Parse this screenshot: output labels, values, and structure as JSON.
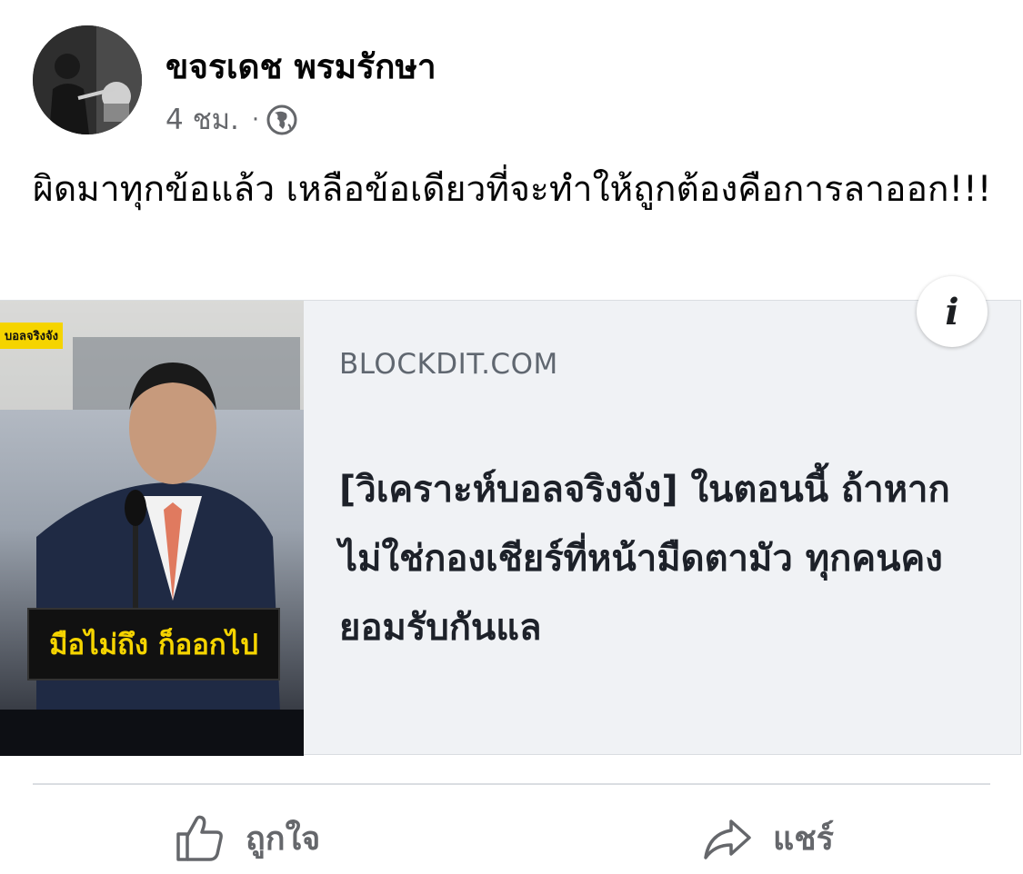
{
  "post": {
    "author": "ขจรเดช พรมรักษา",
    "time": "4 ชม.",
    "separator": "·",
    "privacy_icon": "globe-icon",
    "text": "ผิดมาทุกข้อแล้ว เหลือข้อเดียวที่จะทำให้ถูกต้องคือการลาออก!!!"
  },
  "link_preview": {
    "domain": "BLOCKDIT.COM",
    "title": "[วิเคราะห์บอลจริงจัง] ในตอนนี้ ถ้าหากไม่ใช่กองเชียร์ที่หน้ามืดตามัว ทุกคนคงยอมรับกันแล",
    "thumbnail_tag": "บอลจริงจัง",
    "thumbnail_caption": "มือไม่ถึง ก็ออกไป",
    "info_icon": "info-icon",
    "info_symbol": "i"
  },
  "actions": {
    "like_label": "ถูกใจ",
    "like_icon": "thumbs-up-icon",
    "share_label": "แชร์",
    "share_icon": "share-arrow-icon"
  }
}
